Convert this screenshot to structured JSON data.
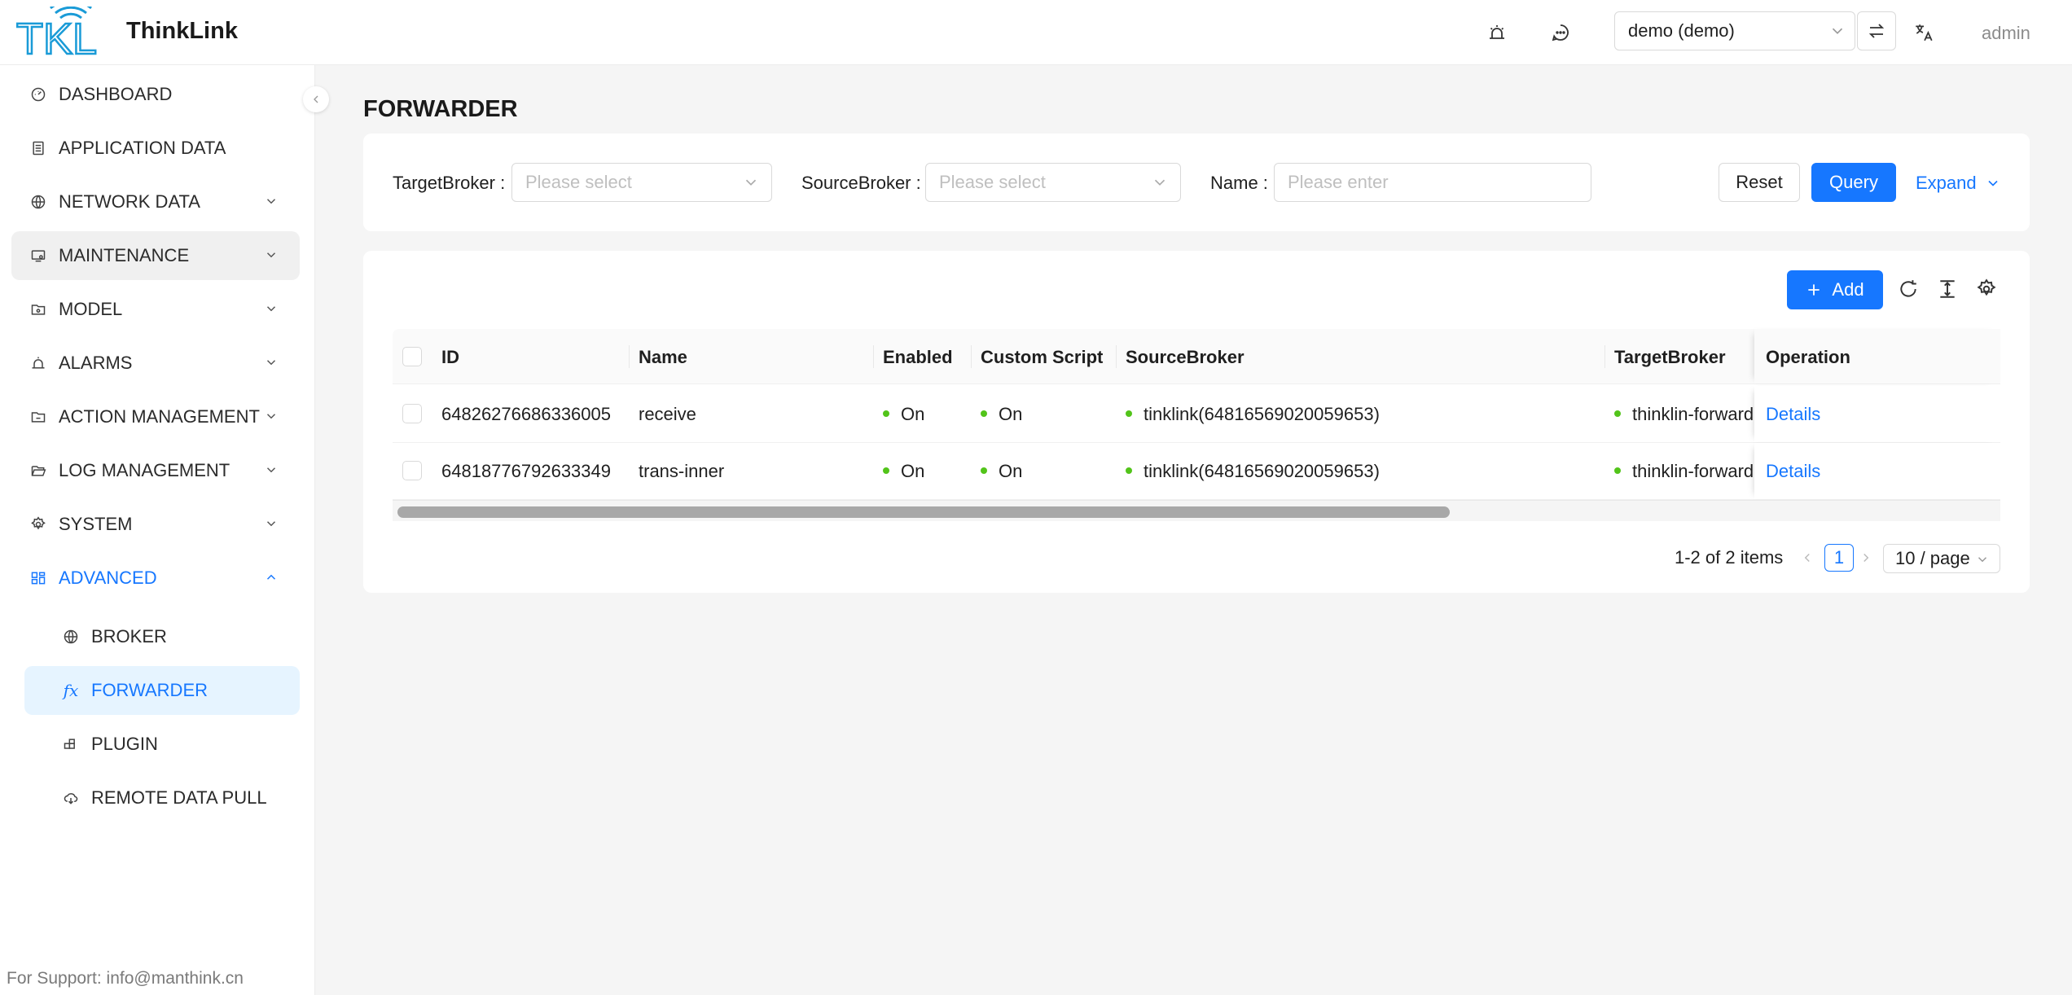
{
  "app": {
    "brand": "ThinkLink",
    "logo_text": "TKL",
    "user": "admin"
  },
  "header": {
    "tenant": "demo (demo)"
  },
  "sidebar": {
    "items": [
      {
        "label": "DASHBOARD",
        "icon": "dashboard-icon"
      },
      {
        "label": "APPLICATION DATA",
        "icon": "document-icon"
      },
      {
        "label": "NETWORK DATA",
        "icon": "globe-icon"
      },
      {
        "label": "MAINTENANCE",
        "icon": "monitor-icon"
      },
      {
        "label": "MODEL",
        "icon": "folder-icon"
      },
      {
        "label": "ALARMS",
        "icon": "alarm-icon"
      },
      {
        "label": "ACTION MANAGEMENT",
        "icon": "folder-icon"
      },
      {
        "label": "LOG MANAGEMENT",
        "icon": "folder-open-icon"
      },
      {
        "label": "SYSTEM",
        "icon": "gear-icon"
      },
      {
        "label": "ADVANCED",
        "icon": "grid-icon"
      }
    ],
    "subitems": [
      {
        "label": "BROKER",
        "icon": "globe-icon"
      },
      {
        "label": "FORWARDER",
        "icon": "function-icon",
        "glyph": "fx"
      },
      {
        "label": "PLUGIN",
        "icon": "plugin-icon"
      },
      {
        "label": "REMOTE DATA PULL",
        "icon": "cloud-download-icon"
      }
    ],
    "support": "For Support: info@manthink.cn"
  },
  "page": {
    "title": "FORWARDER"
  },
  "filters": {
    "target_broker_label": "TargetBroker",
    "target_broker_placeholder": "Please select",
    "source_broker_label": "SourceBroker",
    "source_broker_placeholder": "Please select",
    "name_label": "Name",
    "name_placeholder": "Please enter",
    "reset": "Reset",
    "query": "Query",
    "expand": "Expand"
  },
  "toolbar": {
    "add": "Add"
  },
  "table": {
    "columns": [
      "ID",
      "Name",
      "Enabled",
      "Custom Script",
      "SourceBroker",
      "TargetBroker",
      "Operation"
    ],
    "rows": [
      {
        "id": "64826276686336005",
        "name": "receive",
        "enabled": "On",
        "custom_script": "On",
        "source_broker": "tinklink(64816569020059653)",
        "target_broker": "thinklin-forwarder",
        "operation": "Details"
      },
      {
        "id": "64818776792633349",
        "name": "trans-inner",
        "enabled": "On",
        "custom_script": "On",
        "source_broker": "tinklink(64816569020059653)",
        "target_broker": "thinklin-forwarder",
        "operation": "Details"
      }
    ]
  },
  "pagination": {
    "summary": "1-2 of 2 items",
    "current": "1",
    "page_size": "10 / page"
  },
  "colors": {
    "primary": "#1677ff",
    "success": "#52c41a",
    "selected_bg": "#e6f4ff"
  }
}
